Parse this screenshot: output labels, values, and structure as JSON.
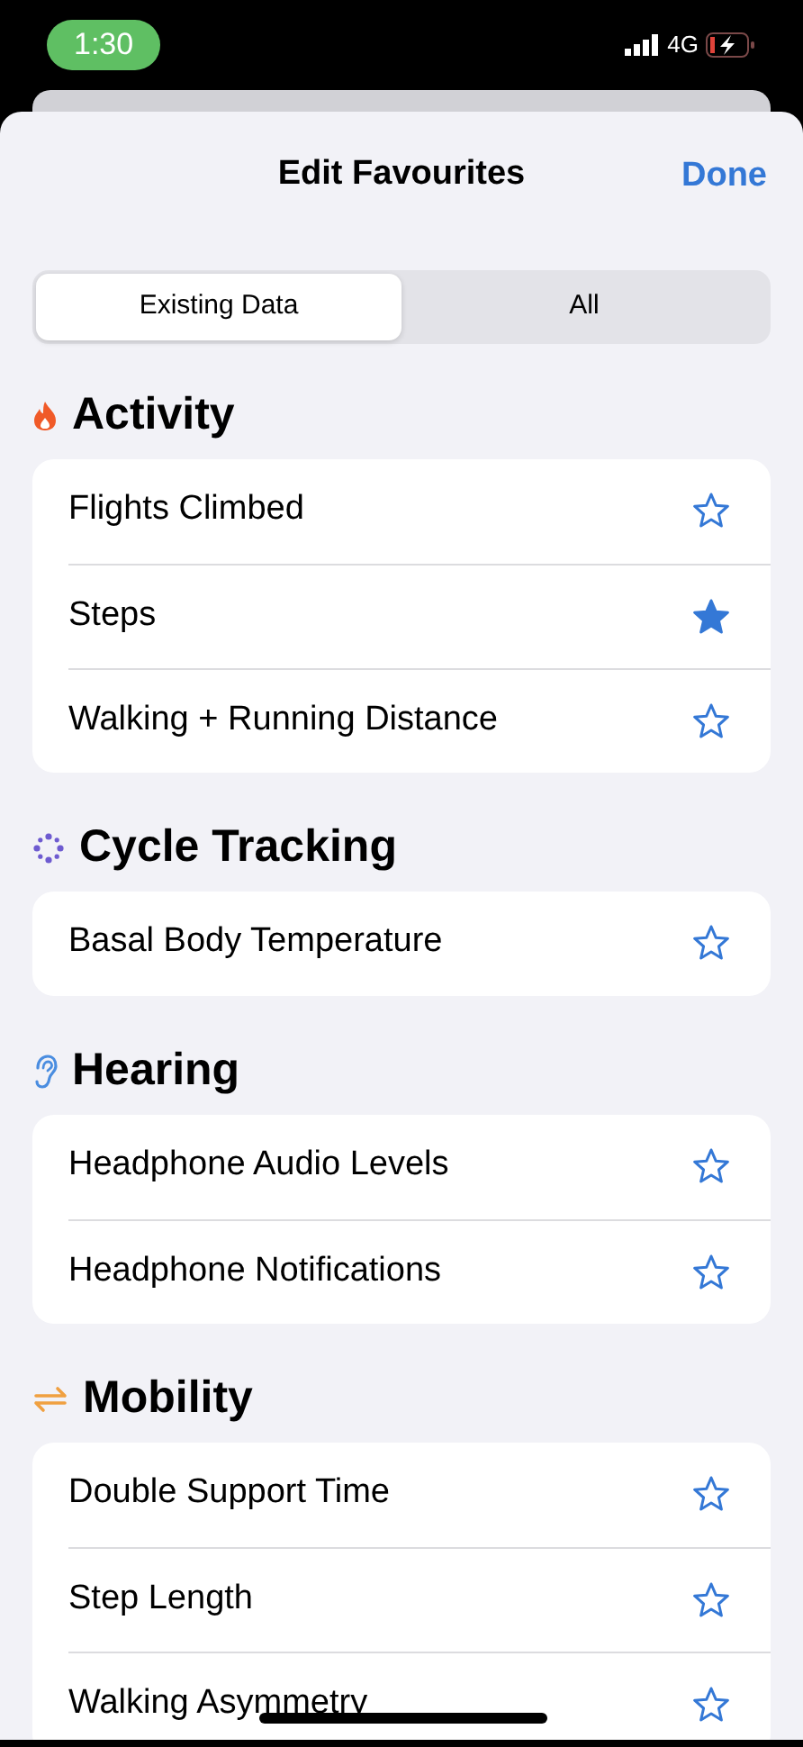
{
  "status_bar": {
    "time": "1:30",
    "network": "4G"
  },
  "header": {
    "title": "Edit Favourites",
    "done": "Done"
  },
  "segments": [
    {
      "label": "Existing Data",
      "selected": true
    },
    {
      "label": "All",
      "selected": false
    }
  ],
  "sections": [
    {
      "title": "Activity",
      "kind": "flame",
      "color": "#f05a28",
      "items": [
        {
          "label": "Flights Climbed",
          "favorite": false
        },
        {
          "label": "Steps",
          "favorite": true
        },
        {
          "label": "Walking + Running Distance",
          "favorite": false
        }
      ]
    },
    {
      "title": "Cycle Tracking",
      "kind": "dots",
      "color": "#6e5bd0",
      "items": [
        {
          "label": "Basal Body Temperature",
          "favorite": false
        }
      ]
    },
    {
      "title": "Hearing",
      "kind": "ear",
      "color": "#4a8de0",
      "items": [
        {
          "label": "Headphone Audio Levels",
          "favorite": false
        },
        {
          "label": "Headphone Notifications",
          "favorite": false
        }
      ]
    },
    {
      "title": "Mobility",
      "kind": "arrows",
      "color": "#f0a040",
      "items": [
        {
          "label": "Double Support Time",
          "favorite": false
        },
        {
          "label": "Step Length",
          "favorite": false
        },
        {
          "label": "Walking Asymmetry",
          "favorite": false
        }
      ]
    }
  ]
}
